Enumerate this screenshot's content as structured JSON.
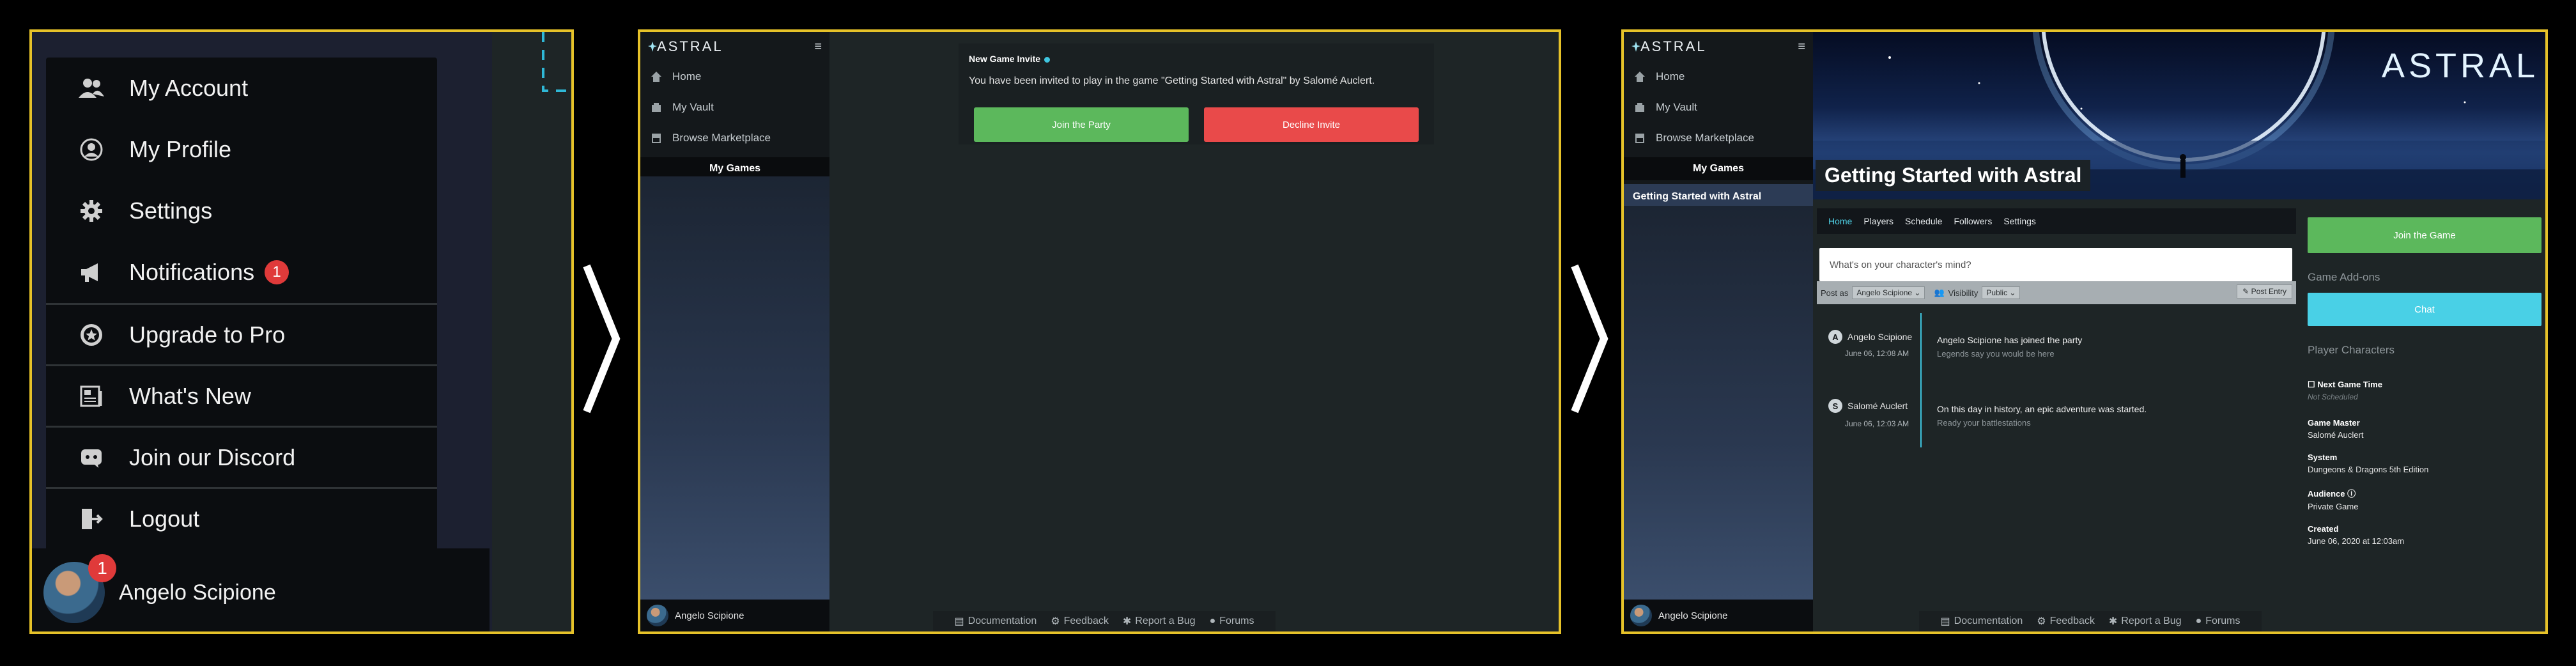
{
  "panel1": {
    "menu_items": [
      {
        "label": "My Account",
        "icon": "users-icon"
      },
      {
        "label": "My Profile",
        "icon": "profile-icon"
      },
      {
        "label": "Settings",
        "icon": "gear-icon"
      },
      {
        "label": "Notifications",
        "icon": "megaphone-icon",
        "badge": "1"
      },
      {
        "label": "Upgrade to Pro",
        "icon": "star-badge-icon"
      },
      {
        "label": "What's New",
        "icon": "news-icon"
      },
      {
        "label": "Join our Discord",
        "icon": "discord-icon"
      },
      {
        "label": "Logout",
        "icon": "logout-icon"
      }
    ],
    "user": {
      "name": "Angelo Scipione",
      "badge": "1"
    }
  },
  "nav": {
    "logo": "ASTRAL",
    "hamburger": "≡",
    "items": [
      {
        "label": "Home",
        "icon": "home-icon"
      },
      {
        "label": "My Vault",
        "icon": "vault-icon"
      },
      {
        "label": "Browse Marketplace",
        "icon": "store-icon"
      }
    ],
    "my_games": "My Games",
    "game_item": "Getting Started with Astral",
    "user": "Angelo Scipione"
  },
  "footer": {
    "items": [
      "Documentation",
      "Feedback",
      "Report a Bug",
      "Forums"
    ]
  },
  "invite": {
    "title": "New Game Invite",
    "message": "You have been invited to play in the game \"Getting Started with Astral\" by Salomé Auclert.",
    "accept": "Join the Party",
    "decline": "Decline Invite"
  },
  "game": {
    "title": "Getting Started with Astral",
    "brand": "ASTRAL",
    "tabs": [
      "Home",
      "Players",
      "Schedule",
      "Followers",
      "Settings"
    ],
    "composer_placeholder": "What's on your character's mind?",
    "post_as_label": "Post as",
    "post_as_value": "Angelo Scipione",
    "visibility_label": "Visibility",
    "visibility_value": "Public",
    "post_entry": "Post Entry",
    "events": [
      {
        "initial": "A",
        "who": "Angelo Scipione",
        "when": "June 06, 12:08 AM",
        "text": "Angelo Scipione has joined the party",
        "sub": "Legends say you would be here"
      },
      {
        "initial": "S",
        "who": "Salomé Auclert",
        "when": "June 06, 12:03 AM",
        "text": "On this day in history, an epic adventure was started.",
        "sub": "Ready your battlestations"
      }
    ],
    "sidebar": {
      "join_button": "Join the Game",
      "addons_heading": "Game Add-ons",
      "chat_button": "Chat",
      "pc_heading": "Player Characters",
      "next_time_label": "Next Game Time",
      "next_time_value": "Not Scheduled",
      "gm_label": "Game Master",
      "gm_value": "Salomé Auclert",
      "system_label": "System",
      "system_value": "Dungeons & Dragons 5th Edition",
      "audience_label": "Audience",
      "audience_value": "Private Game",
      "created_label": "Created",
      "created_value": "June 06, 2020 at 12:03am"
    }
  },
  "colors": {
    "panel_border": "#e6c229",
    "green": "#5cb85c",
    "red": "#e94a4a",
    "cyan": "#49d0e6",
    "badge_red": "#e03a3a"
  }
}
